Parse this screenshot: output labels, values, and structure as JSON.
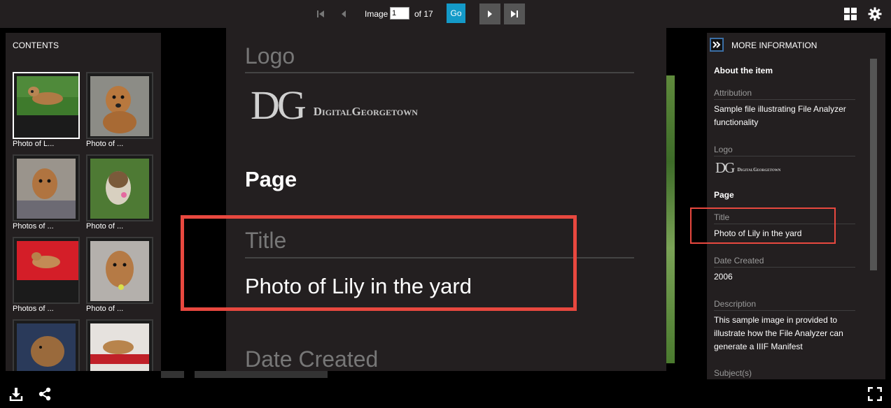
{
  "toolbar": {
    "first_icon": "first-page-icon",
    "prev_icon": "previous-page-icon",
    "image_label": "Image",
    "image_value": "1",
    "of_label": "of 17",
    "go_label": "Go",
    "next_icon": "next-page-icon",
    "last_icon": "last-page-icon",
    "gallery_icon": "gallery-grid-icon",
    "settings_icon": "gear-icon"
  },
  "contents": {
    "title": "CONTENTS",
    "thumbnails": [
      {
        "caption": "Photo of L...",
        "active": true
      },
      {
        "caption": "Photo of ..."
      },
      {
        "caption": "Photos of ..."
      },
      {
        "caption": "Photo of ..."
      },
      {
        "caption": "Photos of ..."
      },
      {
        "caption": "Photo of ..."
      },
      {
        "caption": ""
      },
      {
        "caption": ""
      }
    ]
  },
  "zoom_overlay": {
    "logo_heading": "Logo",
    "page_heading": "Page",
    "title_heading": "Title",
    "title_value": "Photo of Lily in the yard",
    "date_heading": "Date Created"
  },
  "logo": {
    "initials": "DG",
    "wordmark": "DigitalGeorgetown"
  },
  "more_info": {
    "expand_icon": "double-chevron-right-icon",
    "title": "MORE INFORMATION",
    "about": "About the item",
    "attribution_label": "Attribution",
    "attribution_value": "Sample file illustrating File Analyzer functionality",
    "logo_label": "Logo",
    "page_section": "Page",
    "title_label": "Title",
    "title_value": "Photo of Lily in the yard",
    "date_label": "Date Created",
    "date_value": "2006",
    "description_label": "Description",
    "description_value": "This sample image in provided to illustrate how the File Analyzer can generate a IIIF Manifest",
    "subjects_label": "Subject(s)"
  },
  "bottom": {
    "download_icon": "download-icon",
    "share_icon": "share-icon",
    "fullscreen_icon": "fullscreen-icon"
  },
  "colors": {
    "panel_bg": "#231f20",
    "accent_blue": "#149ac8",
    "highlight_red": "#e8483f"
  }
}
